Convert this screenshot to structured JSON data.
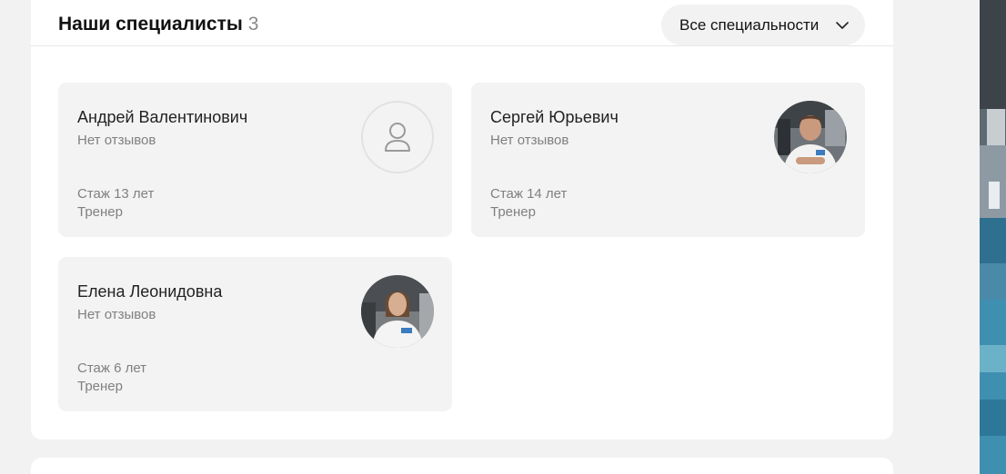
{
  "header": {
    "title": "Наши специалисты",
    "count": "3",
    "filter_label": "Все специальности",
    "filter_icon": "chevron-down-icon"
  },
  "specialists": [
    {
      "name": "Андрей Валентинович",
      "reviews": "Нет отзывов",
      "experience": "Стаж 13 лет",
      "role": "Тренер",
      "avatar": "user-placeholder-icon"
    },
    {
      "name": "Сергей Юрьевич",
      "reviews": "Нет отзывов",
      "experience": "Стаж 14 лет",
      "role": "Тренер",
      "avatar": "photo"
    },
    {
      "name": "Елена Леонидовна",
      "reviews": "Нет отзывов",
      "experience": "Стаж 6 лет",
      "role": "Тренер",
      "avatar": "photo"
    }
  ],
  "colors": {
    "background": "#f2f2f2",
    "panel": "#ffffff",
    "card": "#f3f3f3",
    "muted_text": "#808080"
  }
}
